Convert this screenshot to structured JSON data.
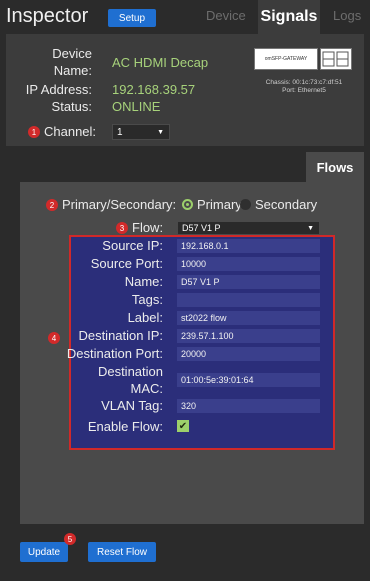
{
  "header": {
    "title": "Inspector",
    "setup_label": "Setup",
    "tabs": [
      "Device",
      "Signals",
      "Logs"
    ],
    "active_tab": "Signals"
  },
  "device": {
    "labels": {
      "name_line1": "Device",
      "name_line2": "Name:",
      "ip": "IP Address:",
      "status": "Status:"
    },
    "values": {
      "name": "AC HDMI Decap",
      "ip": "192.168.39.57",
      "status": "ONLINE"
    },
    "chassis_line1": "Chassis: 00:1c:73:c7:df:51",
    "chassis_line2": "Port: Ethernet5",
    "logo_text": "omSFP-GATEWAY",
    "status_color": "#a7d27b"
  },
  "channel": {
    "label": "Channel:",
    "value": "1",
    "badge": "1"
  },
  "flows_tab": "Flows",
  "mode": {
    "label": "Primary/Secondary:",
    "primary": "Primary",
    "secondary": "Secondary",
    "selected": "Primary",
    "badge": "2"
  },
  "flow_select": {
    "label": "Flow:",
    "value": "D57 V1 P",
    "badge": "3"
  },
  "flow_fields": {
    "badge": "4",
    "source_ip": {
      "label": "Source IP:",
      "value": "192.168.0.1"
    },
    "source_port": {
      "label": "Source Port:",
      "value": "10000"
    },
    "name": {
      "label": "Name:",
      "value": "D57 V1 P"
    },
    "tags": {
      "label": "Tags:",
      "value": ""
    },
    "flabel": {
      "label": "Label:",
      "value": "st2022 flow"
    },
    "dest_ip": {
      "label": "Destination IP:",
      "value": "239.57.1.100"
    },
    "dest_port": {
      "label": "Destination Port:",
      "value": "20000"
    },
    "dest_mac": {
      "label1": "Destination",
      "label2": "MAC:",
      "value": "01:00:5e:39:01:64"
    },
    "vlan": {
      "label": "VLAN Tag:",
      "value": "320"
    },
    "enable": {
      "label": "Enable Flow:",
      "checked": true
    }
  },
  "actions": {
    "update": "Update",
    "reset": "Reset Flow",
    "badge": "5"
  },
  "colors": {
    "accent": "#1f6fd1",
    "highlight_border": "#d02929",
    "badge": "#d22a2a"
  }
}
